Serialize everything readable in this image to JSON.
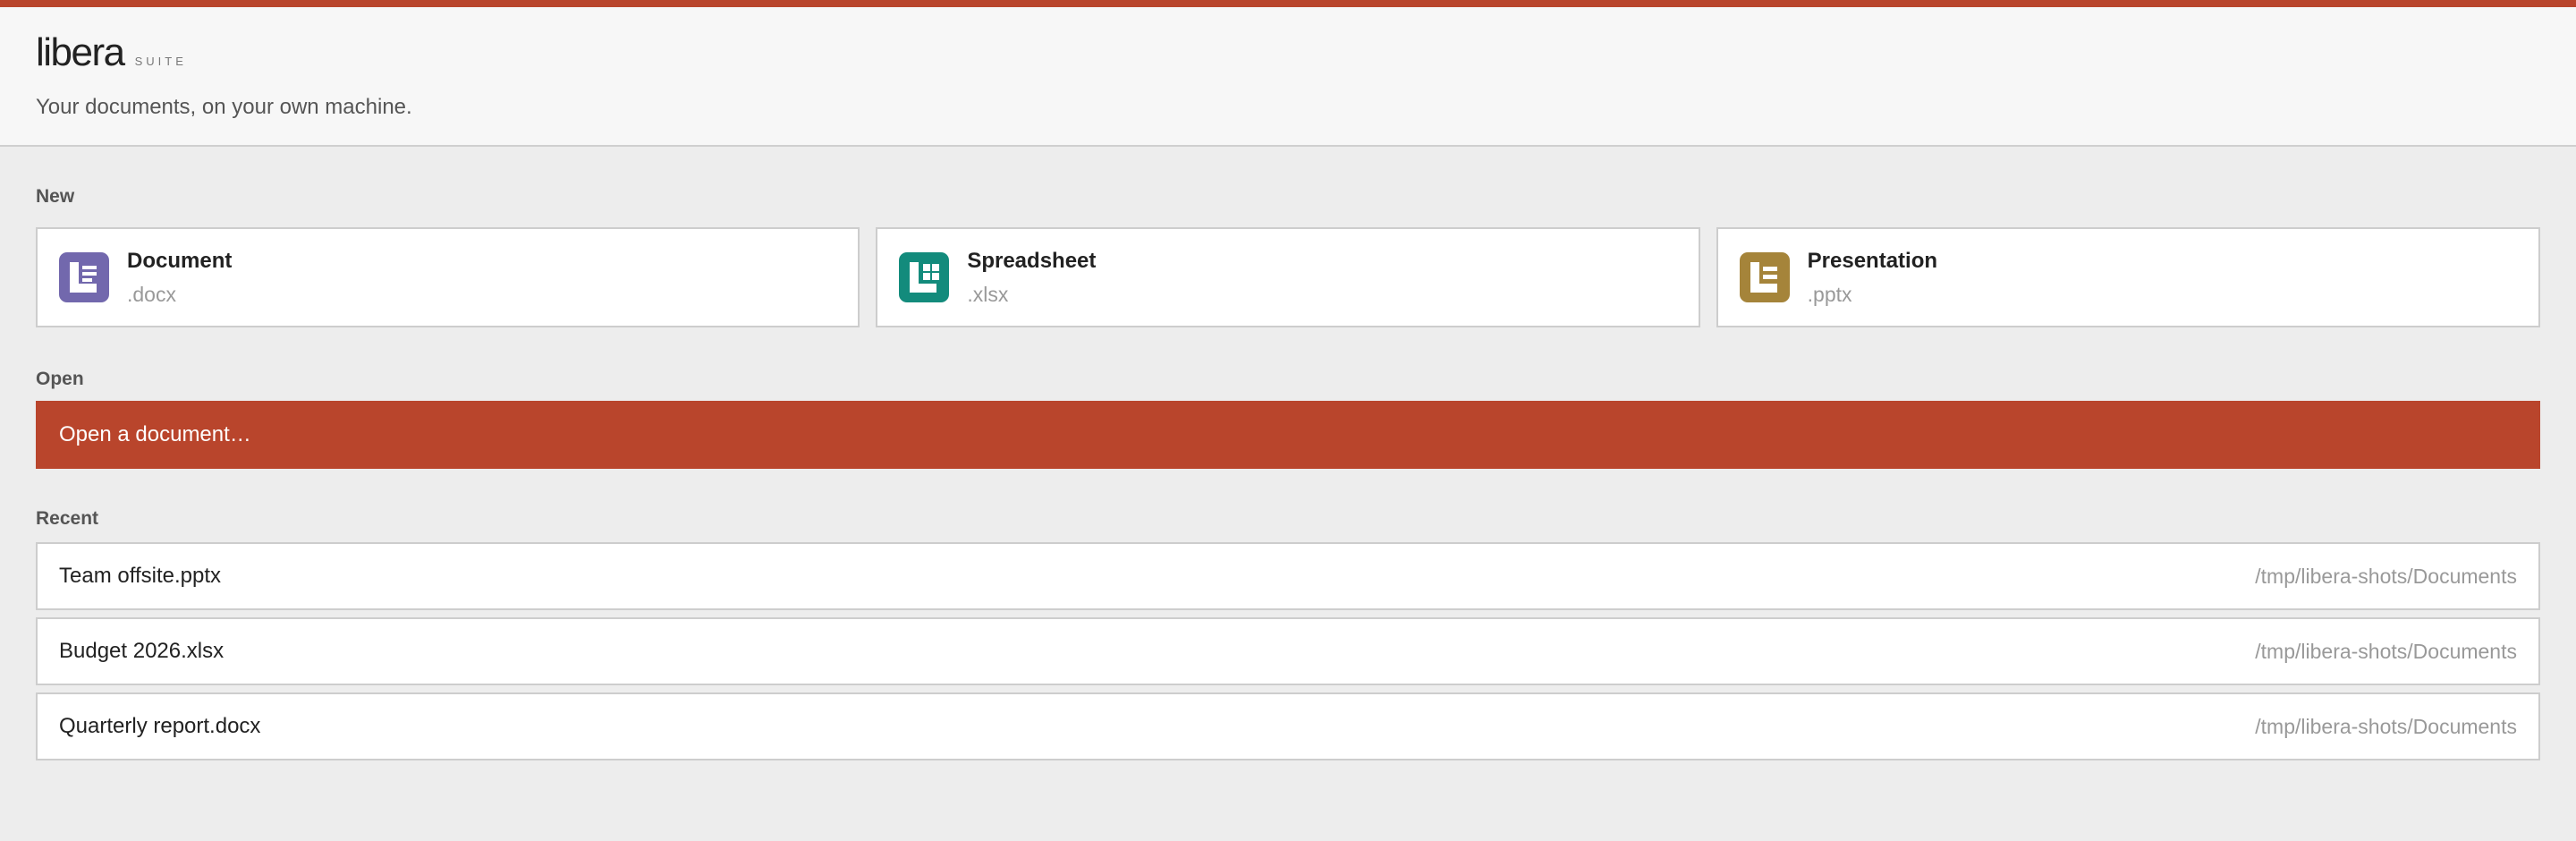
{
  "brand": {
    "name": "libera",
    "suite": "SUITE"
  },
  "tagline": "Your documents, on your own machine.",
  "colors": {
    "accent": "#b9452c",
    "document": "#7268ad",
    "spreadsheet": "#138b7c",
    "presentation": "#a5843a"
  },
  "new_section": {
    "title": "New",
    "cards": [
      {
        "title": "Document",
        "ext": ".docx",
        "icon": "document-icon"
      },
      {
        "title": "Spreadsheet",
        "ext": ".xlsx",
        "icon": "spreadsheet-icon"
      },
      {
        "title": "Presentation",
        "ext": ".pptx",
        "icon": "presentation-icon"
      }
    ]
  },
  "open_section": {
    "title": "Open",
    "button_label": "Open a document…"
  },
  "recent_section": {
    "title": "Recent",
    "items": [
      {
        "name": "Team offsite.pptx",
        "path": "/tmp/libera-shots/Documents"
      },
      {
        "name": "Budget 2026.xlsx",
        "path": "/tmp/libera-shots/Documents"
      },
      {
        "name": "Quarterly report.docx",
        "path": "/tmp/libera-shots/Documents"
      }
    ]
  }
}
